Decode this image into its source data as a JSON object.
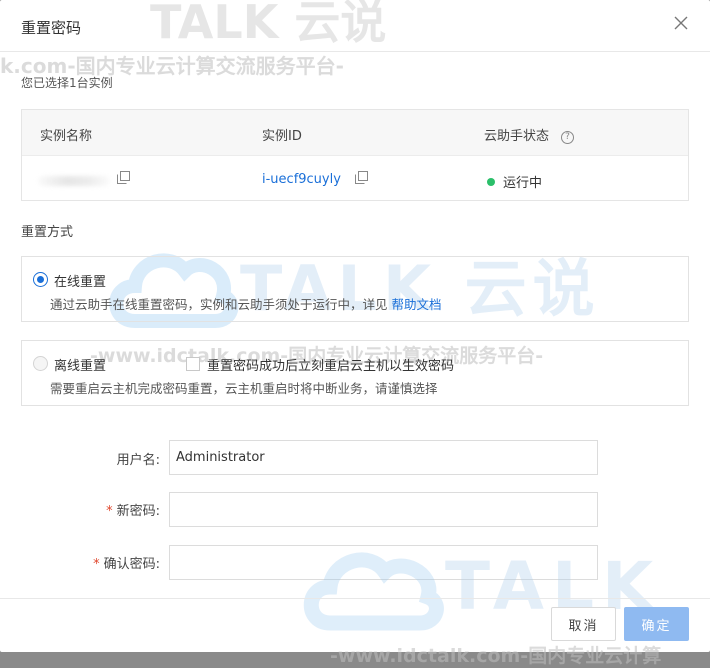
{
  "dialog": {
    "title": "重置密码",
    "selected_note": "您已选择1台实例"
  },
  "watermarks": {
    "top_banner": "TALK 云说",
    "top_line": "k.com-国内专业云计算交流服务平台-",
    "mid_logo": "TALK 云说",
    "mid_line": "-www.idctalk.com-国内专业云计算交流服务平台-",
    "bottom_logo": "TALK",
    "bottom_line": "-www.idctalk.com-国内专业云计算"
  },
  "table": {
    "headers": {
      "name": "实例名称",
      "id": "实例ID",
      "agent_status": "云助手状态"
    },
    "row": {
      "instance_id": "i-uecf9cuyly",
      "status": "运行中"
    },
    "help_glyph": "?",
    "status_color": "#2bbf6a"
  },
  "reset_method": {
    "label": "重置方式",
    "online": {
      "title": "在线重置",
      "desc": "通过云助手在线重置密码，实例和云助手须处于运行中，详见",
      "link": "帮助文档",
      "selected": true
    },
    "offline": {
      "title": "离线重置",
      "checkbox_label": "重置密码成功后立刻重启云主机以生效密码",
      "desc": "需要重启云主机完成密码重置，云主机重启时将中断业务，请谨慎选择",
      "selected": false
    }
  },
  "form": {
    "username_label": "用户名:",
    "username_value": "Administrator",
    "new_password_label": "新密码:",
    "new_password_value": "",
    "confirm_password_label": "确认密码:",
    "confirm_password_value": "",
    "required_mark": "*"
  },
  "buttons": {
    "cancel": "取消",
    "ok": "确定"
  },
  "colors": {
    "accent": "#1a6fd8",
    "ok_button": "#8fbaf1",
    "required": "#e0452b"
  }
}
